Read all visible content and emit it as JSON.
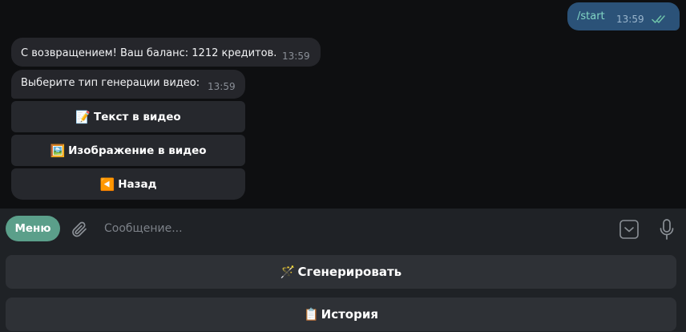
{
  "outgoing": {
    "text": "/start",
    "time": "13:59",
    "status_icon": "double-check-icon"
  },
  "incoming": [
    {
      "text": "С возвращением! Ваш баланс: 1212 кредитов.",
      "time": "13:59"
    },
    {
      "text": "Выберите тип генерации видео:",
      "time": "13:59"
    }
  ],
  "inline_buttons": [
    {
      "emoji": "📝",
      "label": "Текст в видео",
      "icon": "memo-icon"
    },
    {
      "emoji": "🖼️",
      "label": "Изображение в видео",
      "icon": "framed-picture-icon"
    },
    {
      "emoji": "◀️",
      "label": "Назад",
      "icon": "back-arrow-icon"
    }
  ],
  "composer": {
    "menu_label": "Меню",
    "placeholder": "Сообщение..."
  },
  "reply_keyboard": [
    {
      "emoji": "🪄",
      "label": "Сгенерировать",
      "icon": "magic-wand-icon"
    },
    {
      "emoji": "📋",
      "label": "История",
      "icon": "clipboard-icon"
    }
  ],
  "colors": {
    "background": "#0e0f11",
    "outgoing_bubble": "#2b5278",
    "incoming_bubble": "#25262b",
    "accent_menu": "#5b9f8a",
    "composer": "#1f2226"
  }
}
